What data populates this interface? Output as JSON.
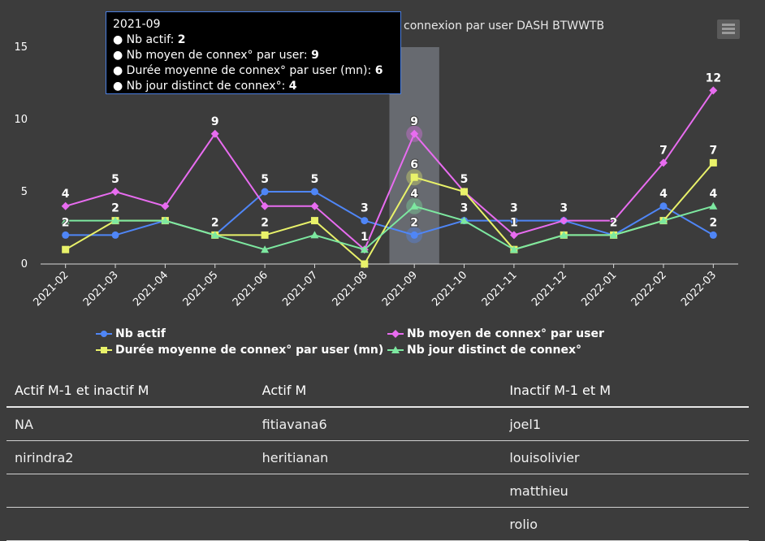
{
  "title": "connexion par user DASH BTWWTB",
  "menu_icon": "hamburger-menu-icon",
  "tooltip": {
    "header": "2021-09",
    "rows": [
      {
        "label": "Nb actif: ",
        "value": "2"
      },
      {
        "label": "Nb moyen de connex° par user: ",
        "value": "9"
      },
      {
        "label": "Durée moyenne de connex° par user (mn): ",
        "value": "6"
      },
      {
        "label": "Nb jour distinct de connex°: ",
        "value": "4"
      }
    ]
  },
  "chart_data": {
    "type": "line",
    "categories": [
      "2021-02",
      "2021-03",
      "2021-04",
      "2021-05",
      "2021-06",
      "2021-07",
      "2021-08",
      "2021-09",
      "2021-10",
      "2021-11",
      "2021-12",
      "2022-01",
      "2022-02",
      "2022-03"
    ],
    "ylim": [
      0,
      15
    ],
    "yticks": [
      0,
      5,
      10,
      15
    ],
    "highlight_category": "2021-09",
    "grid": false,
    "legend_position": "bottom",
    "series": [
      {
        "name": "Nb actif",
        "color": "#4f86f7",
        "marker": "circle",
        "values": [
          2,
          2,
          3,
          2,
          5,
          5,
          3,
          2,
          3,
          3,
          3,
          2,
          4,
          2
        ]
      },
      {
        "name": "Nb moyen de connex° par user",
        "color": "#e86cf0",
        "marker": "diamond",
        "values": [
          4,
          5,
          4,
          9,
          4,
          4,
          1,
          9,
          5,
          2,
          3,
          3,
          7,
          12
        ]
      },
      {
        "name": "Durée moyenne de connex° par user (mn)",
        "color": "#e9f26a",
        "marker": "square",
        "values": [
          1,
          3,
          3,
          2,
          2,
          3,
          0,
          6,
          5,
          1,
          2,
          2,
          3,
          7
        ]
      },
      {
        "name": "Nb jour distinct de connex°",
        "color": "#7de8a0",
        "marker": "triangle",
        "values": [
          3,
          3,
          3,
          2,
          1,
          2,
          1,
          4,
          3,
          1,
          2,
          2,
          3,
          4
        ]
      }
    ],
    "data_labels": [
      {
        "category": "2021-02",
        "series": "Nb moyen de connex° par user",
        "text": "4"
      },
      {
        "category": "2021-02",
        "series": "Nb actif",
        "text": "2"
      },
      {
        "category": "2021-03",
        "series": "Nb moyen de connex° par user",
        "text": "5"
      },
      {
        "category": "2021-03",
        "series": "Nb jour distinct de connex°",
        "text": "2"
      },
      {
        "category": "2021-05",
        "series": "Nb moyen de connex° par user",
        "text": "9"
      },
      {
        "category": "2021-05",
        "series": "Nb actif",
        "text": "2"
      },
      {
        "category": "2021-06",
        "series": "Nb actif",
        "text": "5"
      },
      {
        "category": "2021-06",
        "series": "Durée moyenne de connex° par user (mn)",
        "text": "2"
      },
      {
        "category": "2021-07",
        "series": "Nb actif",
        "text": "5"
      },
      {
        "category": "2021-08",
        "series": "Nb actif",
        "text": "3"
      },
      {
        "category": "2021-08",
        "series": "Nb moyen de connex° par user",
        "text": "1"
      },
      {
        "category": "2021-09",
        "series": "Nb moyen de connex° par user",
        "text": "9"
      },
      {
        "category": "2021-09",
        "series": "Durée moyenne de connex° par user (mn)",
        "text": "6"
      },
      {
        "category": "2021-09",
        "series": "Nb jour distinct de connex°",
        "text": "4"
      },
      {
        "category": "2021-09",
        "series": "Nb actif",
        "text": "2"
      },
      {
        "category": "2021-10",
        "series": "Nb moyen de connex° par user",
        "text": "5"
      },
      {
        "category": "2021-10",
        "series": "Nb jour distinct de connex°",
        "text": "3"
      },
      {
        "category": "2021-11",
        "series": "Nb actif",
        "text": "3"
      },
      {
        "category": "2021-11",
        "series": "Nb moyen de connex° par user",
        "text": "1"
      },
      {
        "category": "2021-12",
        "series": "Nb actif",
        "text": "3"
      },
      {
        "category": "2022-01",
        "series": "Nb actif",
        "text": "2"
      },
      {
        "category": "2022-02",
        "series": "Nb moyen de connex° par user",
        "text": "7"
      },
      {
        "category": "2022-02",
        "series": "Nb actif",
        "text": "4"
      },
      {
        "category": "2022-03",
        "series": "Nb moyen de connex° par user",
        "text": "12"
      },
      {
        "category": "2022-03",
        "series": "Durée moyenne de connex° par user (mn)",
        "text": "7"
      },
      {
        "category": "2022-03",
        "series": "Nb jour distinct de connex°",
        "text": "4"
      },
      {
        "category": "2022-03",
        "series": "Nb actif",
        "text": "2"
      }
    ]
  },
  "legend": {
    "items": [
      {
        "label": "Nb actif"
      },
      {
        "label": "Nb moyen de connex° par user"
      },
      {
        "label": "Durée moyenne de connex° par user (mn)"
      },
      {
        "label": "Nb jour distinct de connex°"
      }
    ]
  },
  "table": {
    "headers": [
      "Actif M-1 et inactif M",
      "Actif M",
      "Inactif M-1 et M"
    ],
    "rows": [
      [
        "NA",
        "fitiavana6",
        "joel1"
      ],
      [
        "nirindra2",
        "heritianan",
        "louisolivier"
      ],
      [
        "",
        "",
        "matthieu"
      ],
      [
        "",
        "",
        "rolio"
      ]
    ]
  }
}
